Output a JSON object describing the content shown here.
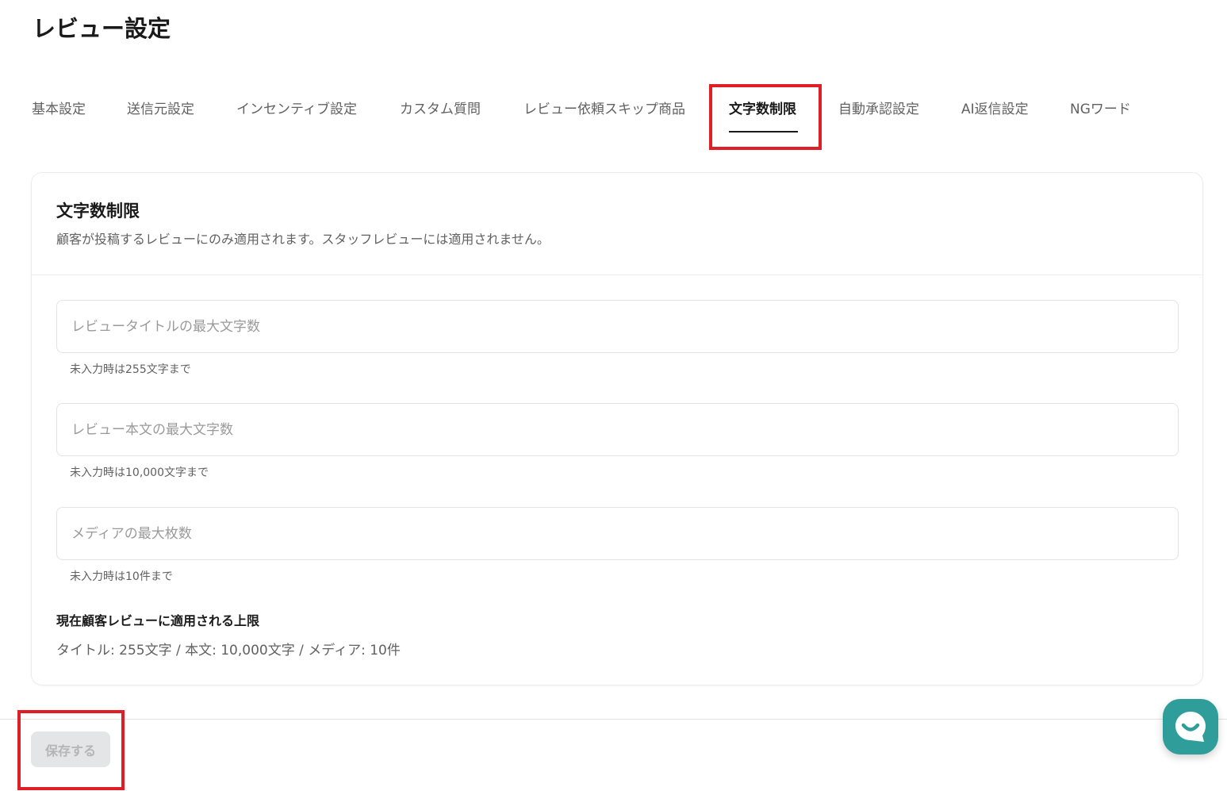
{
  "page": {
    "title": "レビュー設定"
  },
  "tabs": [
    {
      "label": "基本設定",
      "active": false
    },
    {
      "label": "送信元設定",
      "active": false
    },
    {
      "label": "インセンティブ設定",
      "active": false
    },
    {
      "label": "カスタム質問",
      "active": false
    },
    {
      "label": "レビュー依頼スキップ商品",
      "active": false
    },
    {
      "label": "文字数制限",
      "active": true
    },
    {
      "label": "自動承認設定",
      "active": false
    },
    {
      "label": "AI返信設定",
      "active": false
    },
    {
      "label": "NGワード",
      "active": false
    }
  ],
  "card": {
    "title": "文字数制限",
    "description": "顧客が投稿するレビューにのみ適用されます。スタッフレビューには適用されません。",
    "fields": [
      {
        "placeholder": "レビュータイトルの最大文字数",
        "value": "",
        "help": "未入力時は255文字まで"
      },
      {
        "placeholder": "レビュー本文の最大文字数",
        "value": "",
        "help": "未入力時は10,000文字まで"
      },
      {
        "placeholder": "メディアの最大枚数",
        "value": "",
        "help": "未入力時は10件まで"
      }
    ],
    "current_limits": {
      "heading": "現在顧客レビューに適用される上限",
      "value": "タイトル: 255文字 / 本文: 10,000文字 / メディア: 10件"
    }
  },
  "footer": {
    "save_label": "保存する",
    "save_enabled": false
  },
  "colors": {
    "highlight": "#e01e26",
    "chat_accent": "#2f9d99",
    "text_primary": "#1a1a1a",
    "text_secondary": "#616161"
  },
  "icons": {
    "chat": "chat-bubble-smile-icon"
  }
}
